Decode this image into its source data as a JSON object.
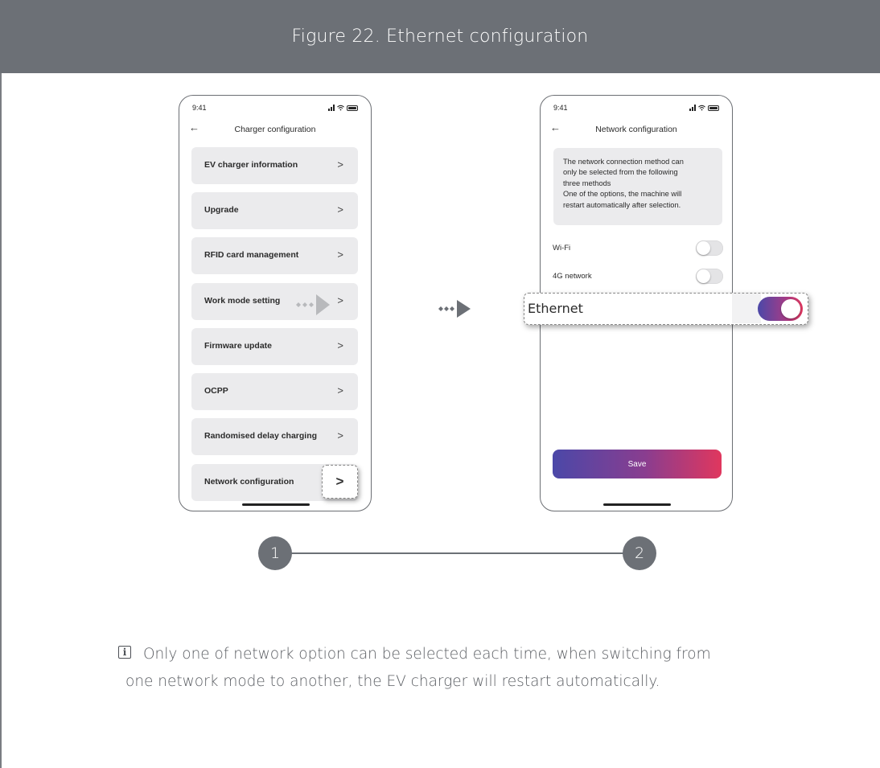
{
  "figure": {
    "title": "Figure 22.  Ethernet configuration"
  },
  "phone1": {
    "time": "9:41",
    "title": "Charger configuration",
    "items": [
      {
        "label": "EV charger information",
        "chevron": ">"
      },
      {
        "label": "Upgrade",
        "chevron": ">"
      },
      {
        "label": "RFID card management",
        "chevron": ">"
      },
      {
        "label": "Work mode setting",
        "chevron": ">"
      },
      {
        "label": "Firmware update",
        "chevron": ">"
      },
      {
        "label": "OCPP",
        "chevron": ">"
      },
      {
        "label": "Randomised delay charging",
        "chevron": ">"
      },
      {
        "label": "Network configuration",
        "chevron": ">"
      }
    ],
    "callout_chevron": ">"
  },
  "phone2": {
    "time": "9:41",
    "title": "Network configuration",
    "info_lines": [
      "The network connection method can",
      "only be selected from the following",
      "three methods",
      "One of the options, the machine will",
      "restart automatically after selection."
    ],
    "options": [
      {
        "label": "Wi-Fi",
        "enabled": false
      },
      {
        "label": "4G network",
        "enabled": false
      },
      {
        "label": "Ethernet",
        "enabled": true
      }
    ],
    "save_label": "Save"
  },
  "colors": {
    "header_bg": "#6c7076",
    "accent_start": "#4b48a8",
    "accent_end": "#e0375e"
  },
  "steps": [
    {
      "number": "1"
    },
    {
      "number": "2"
    }
  ],
  "note": {
    "icon": "info-icon",
    "line1": "Only one of network option can be selected each time, when switching from",
    "line2": "one network mode to another, the EV charger will restart automatically."
  }
}
